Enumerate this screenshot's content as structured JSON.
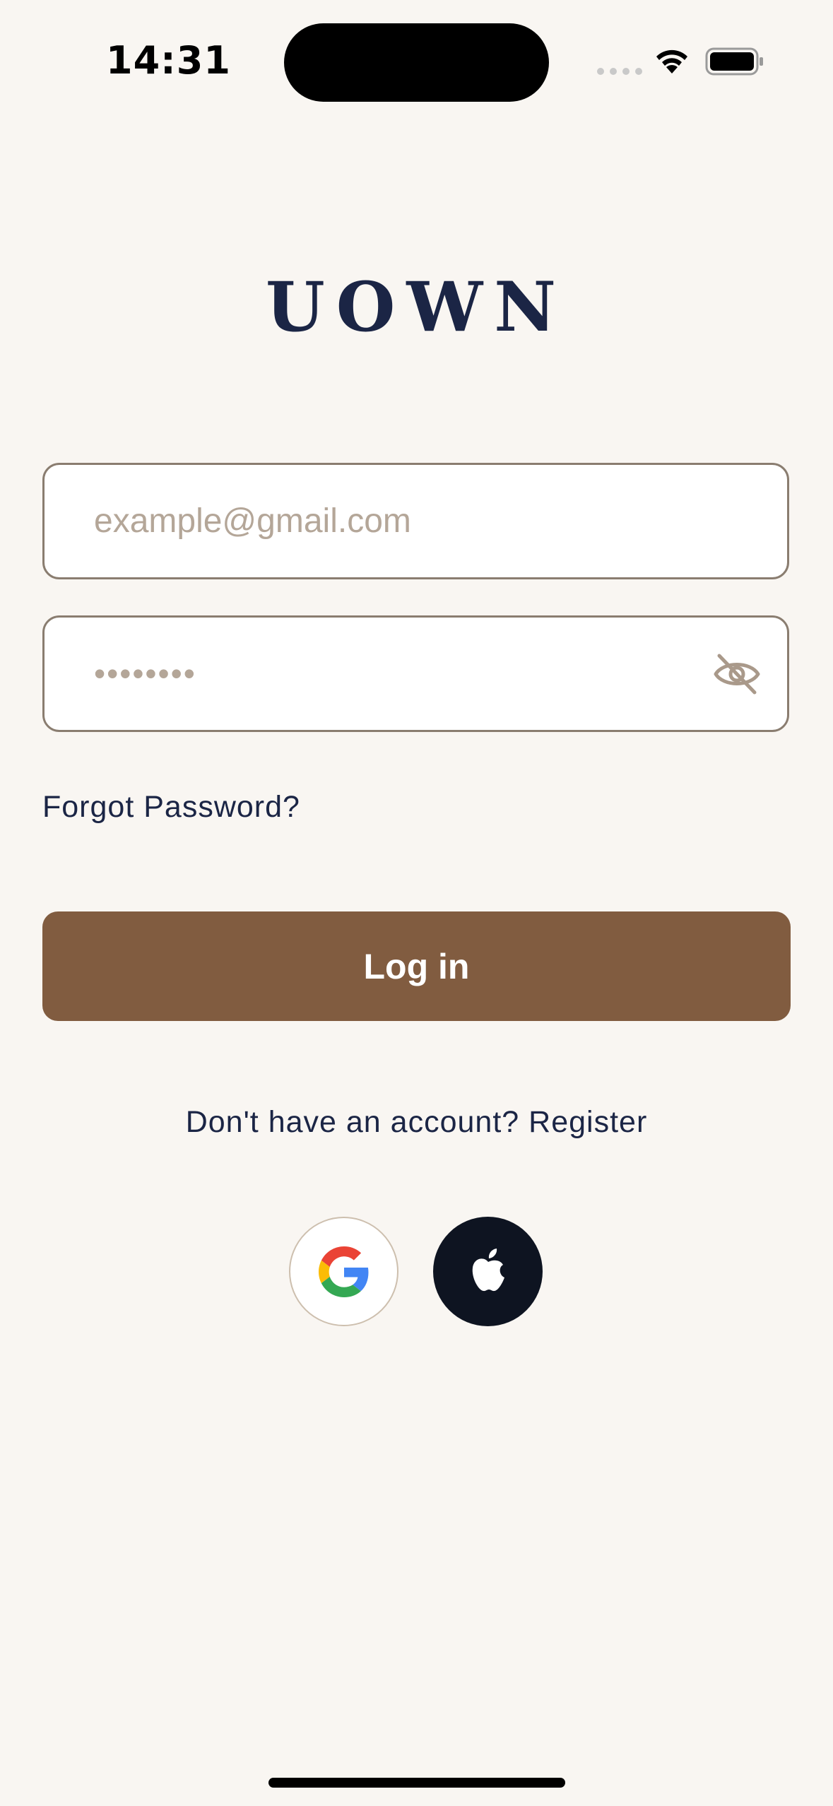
{
  "status_bar": {
    "time": "14:31"
  },
  "app": {
    "logo_text": "UOWN"
  },
  "form": {
    "email_placeholder": "example@gmail.com",
    "password_masked": "••••••••",
    "forgot_password_label": "Forgot Password?",
    "login_label": "Log in"
  },
  "register": {
    "prompt": "Don't have an account?",
    "link_label": "Register"
  },
  "social": {
    "google_icon": "google-icon",
    "apple_icon": "apple-icon"
  },
  "colors": {
    "background": "#f9f6f2",
    "brand_navy": "#1b2545",
    "button_brown": "#815c40",
    "apple_button": "#0e1421",
    "field_border": "#8a7d70",
    "placeholder": "#b4a698"
  }
}
